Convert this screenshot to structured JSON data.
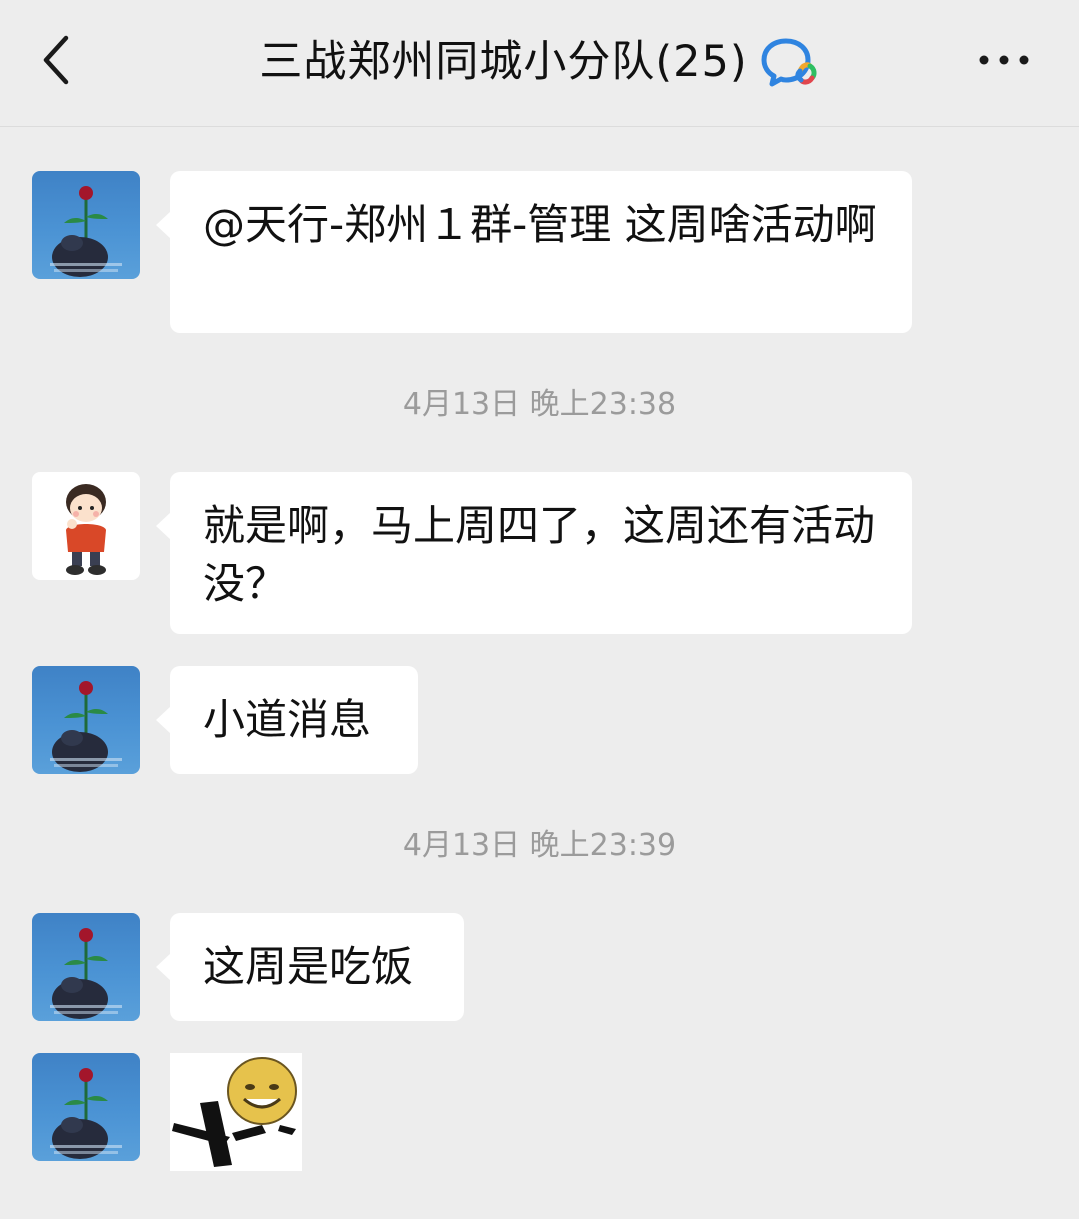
{
  "header": {
    "back_icon": "chevron-left-icon",
    "title": "三战郑州同城小分队(25)",
    "title_icon": "enterprise-chat-icon",
    "more_icon": "more-dots-icon"
  },
  "messages": [
    {
      "type": "text",
      "avatar": "rose-avatar",
      "text": "@天行-郑州１群-管理  这周啥活动啊"
    },
    {
      "type": "timestamp",
      "text": "4月13日 晚上23:38"
    },
    {
      "type": "text",
      "avatar": "cartoon-boy-avatar",
      "text": "就是啊，马上周四了，这周还有活动没？"
    },
    {
      "type": "text",
      "avatar": "rose-avatar",
      "text": "小道消息"
    },
    {
      "type": "timestamp",
      "text": "4月13日 晚上23:39"
    },
    {
      "type": "text",
      "avatar": "rose-avatar",
      "text": "这周是吃饭"
    },
    {
      "type": "sticker",
      "avatar": "rose-avatar",
      "sticker": "smiley-face-sticker"
    }
  ],
  "colors": {
    "background": "#ededed",
    "bubble": "#ffffff",
    "timestamp": "#9b9b9b",
    "avatar_sky": "#4b93d4"
  }
}
